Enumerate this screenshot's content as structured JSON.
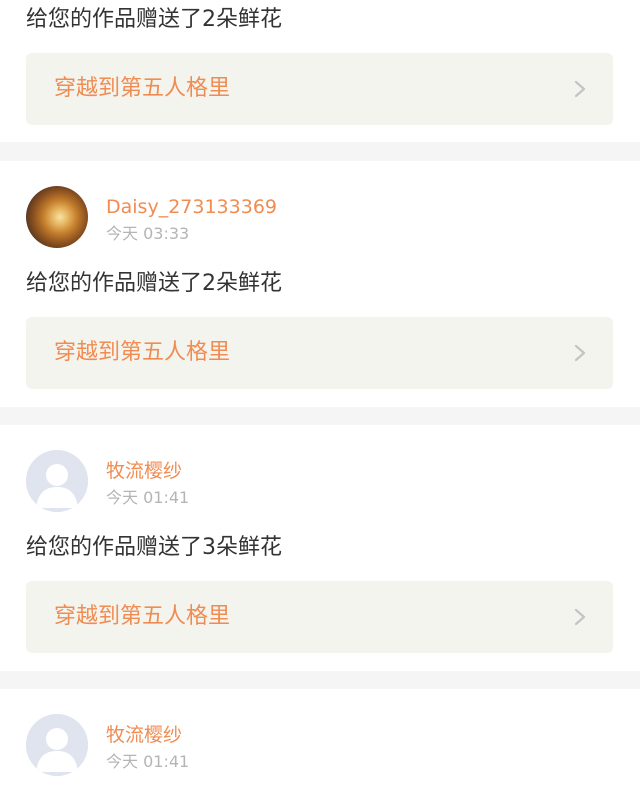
{
  "notifications": [
    {
      "user": "",
      "time": "",
      "message": "给您的作品赠送了2朵鲜花",
      "work_title": "穿越到第五人格里"
    },
    {
      "user": "Daisy_273133369",
      "time": "今天 03:33",
      "message": "给您的作品赠送了2朵鲜花",
      "work_title": "穿越到第五人格里",
      "avatar": "photo-avatar"
    },
    {
      "user": "牧流樱纱",
      "time": "今天 01:41",
      "message": "给您的作品赠送了3朵鲜花",
      "work_title": "穿越到第五人格里",
      "avatar": "default-avatar"
    },
    {
      "user": "牧流樱纱",
      "time": "今天 01:41",
      "avatar": "default-avatar"
    }
  ],
  "colors": {
    "accent": "#f08c52",
    "text": "#333333",
    "muted": "#b5b5b5",
    "link_bg": "#f4f4ee",
    "separator": "#f5f5f5"
  },
  "icons": {
    "link_arrow": "chevron-right-icon",
    "default_avatar": "user-silhouette-icon"
  }
}
